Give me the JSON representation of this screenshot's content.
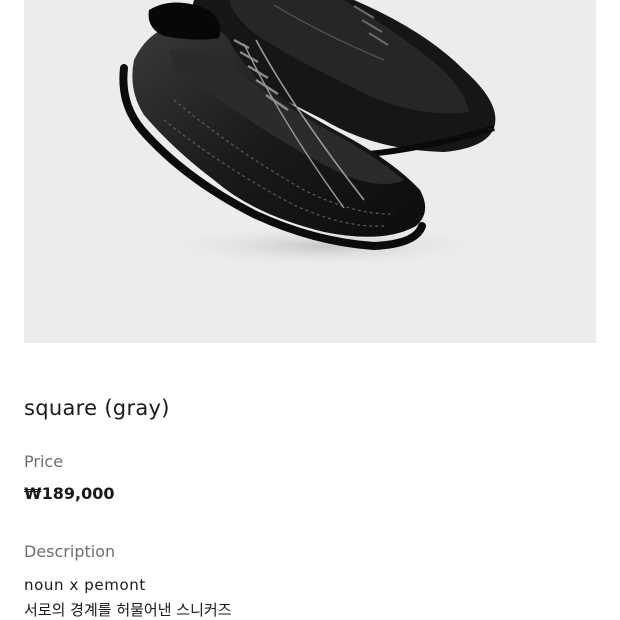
{
  "product": {
    "image_name": "black-leather-suede-sneakers",
    "title": "square (gray)",
    "price_label": "Price",
    "price": "₩189,000",
    "description_label": "Description",
    "description_lines": [
      "noun x pemont",
      "서로의 경계를 허물어낸 스니커즈"
    ]
  },
  "colors": {
    "photo_background": "#ececec",
    "label_gray": "#6e6e6e",
    "text_dark": "#1a1a1a"
  }
}
